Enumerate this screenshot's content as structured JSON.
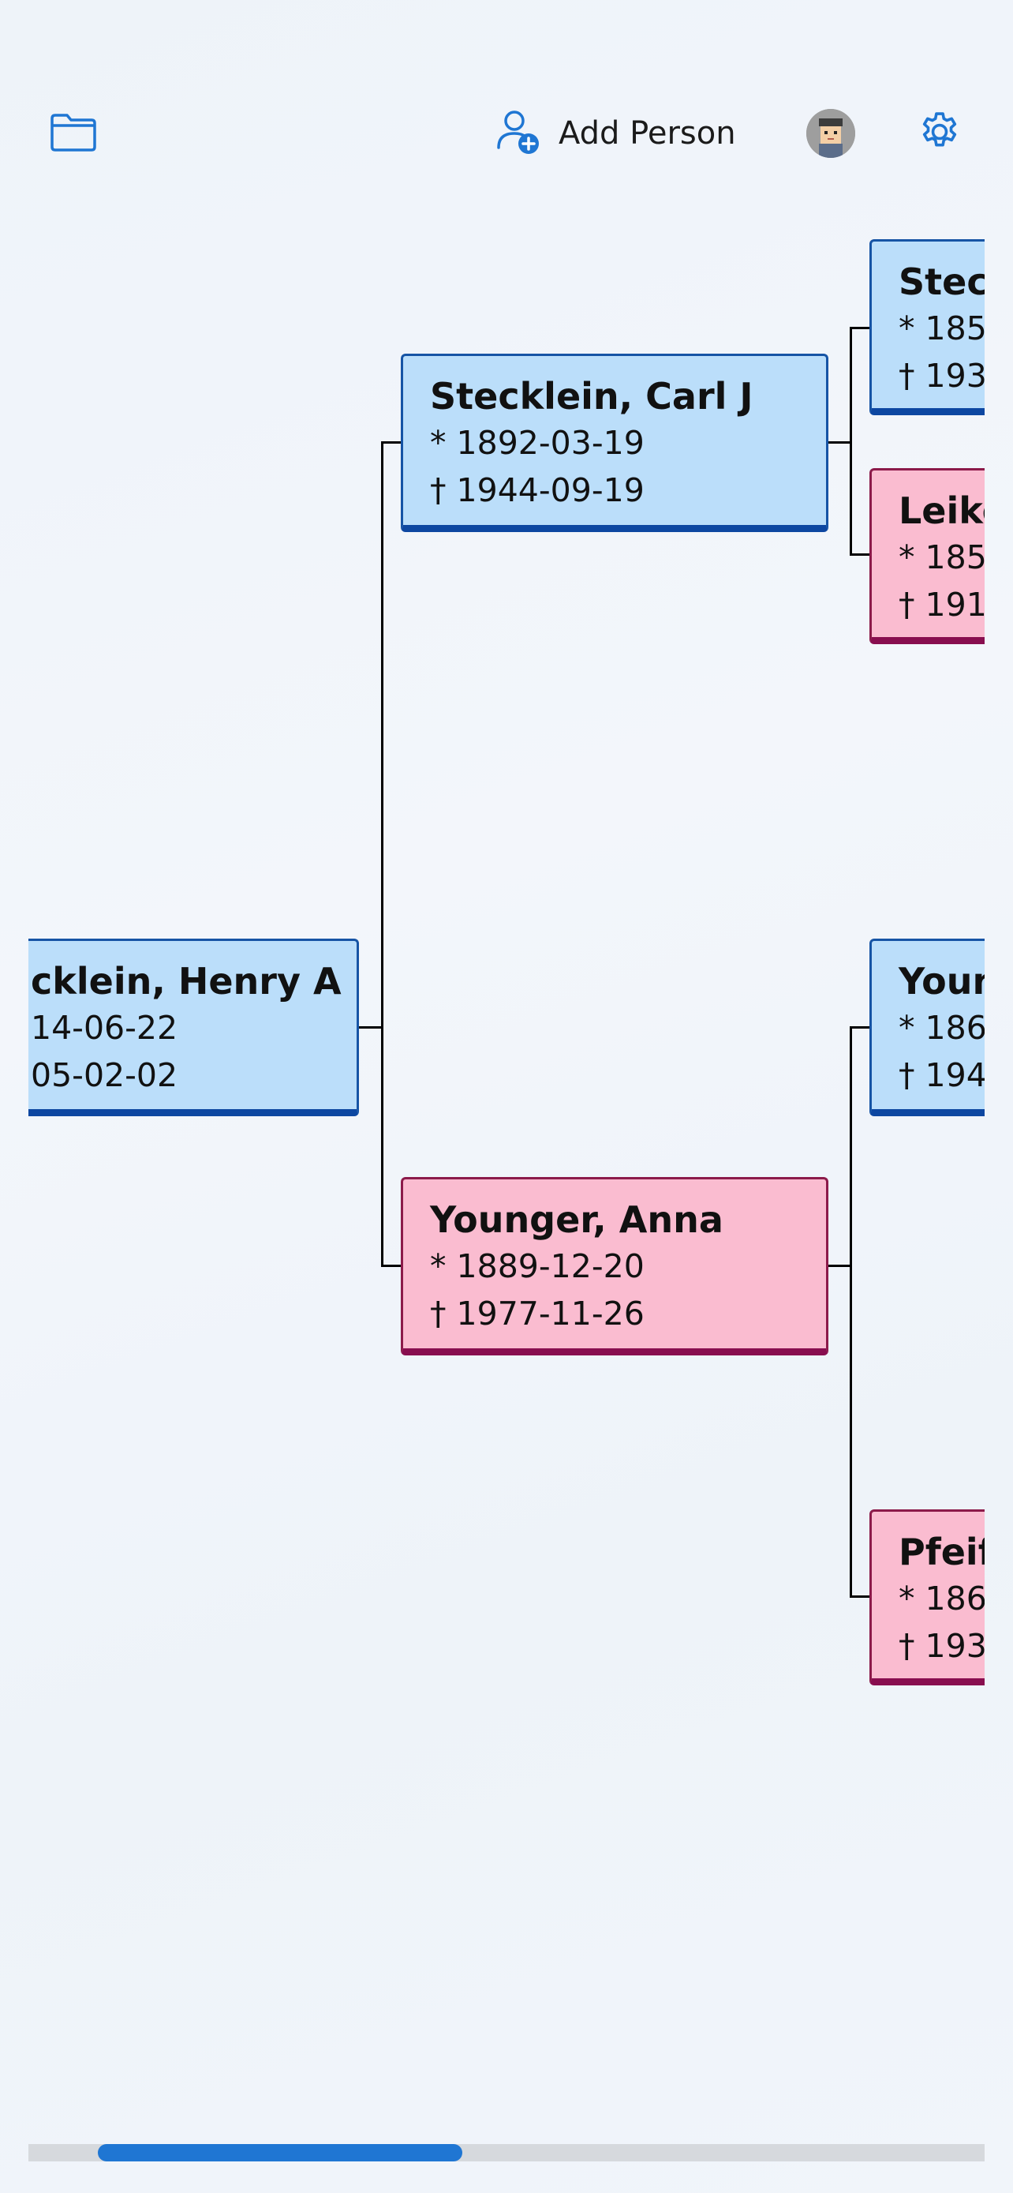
{
  "toolbar": {
    "open_icon": "folder-icon",
    "add_person_icon": "person-add-icon",
    "add_person_label": "Add Person",
    "avatar_icon": "avatar",
    "settings_icon": "gear-icon",
    "accent_color": "#1f76d3"
  },
  "tree": {
    "root": {
      "name": "cklein, Henry A",
      "born": "14-06-22",
      "died": "05-02-02",
      "sex": "male"
    },
    "father": {
      "name": "Stecklein, Carl J",
      "born": "* 1892-03-19",
      "died": "† 1944-09-19",
      "sex": "male"
    },
    "mother": {
      "name": "Younger, Anna",
      "born": "* 1889-12-20",
      "died": "† 1977-11-26",
      "sex": "female"
    },
    "paternal_grandfather": {
      "name": "Steck",
      "born": "* 185",
      "died": "† 193",
      "sex": "male"
    },
    "paternal_grandmother": {
      "name": "Leike",
      "born": "* 185",
      "died": "† 191",
      "sex": "female"
    },
    "maternal_grandfather": {
      "name": "Youn",
      "born": "* 186",
      "died": "† 194",
      "sex": "male"
    },
    "maternal_grandmother": {
      "name": "Pfeif",
      "born": "* 186",
      "died": "† 193",
      "sex": "female"
    },
    "colors": {
      "male_fill": "#bbdefa",
      "male_border": "#0d47a1",
      "female_fill": "#fabcd0",
      "female_border": "#880e4f"
    }
  },
  "scrollbar": {
    "position_fraction": 0.07,
    "visible_fraction": 0.38
  }
}
